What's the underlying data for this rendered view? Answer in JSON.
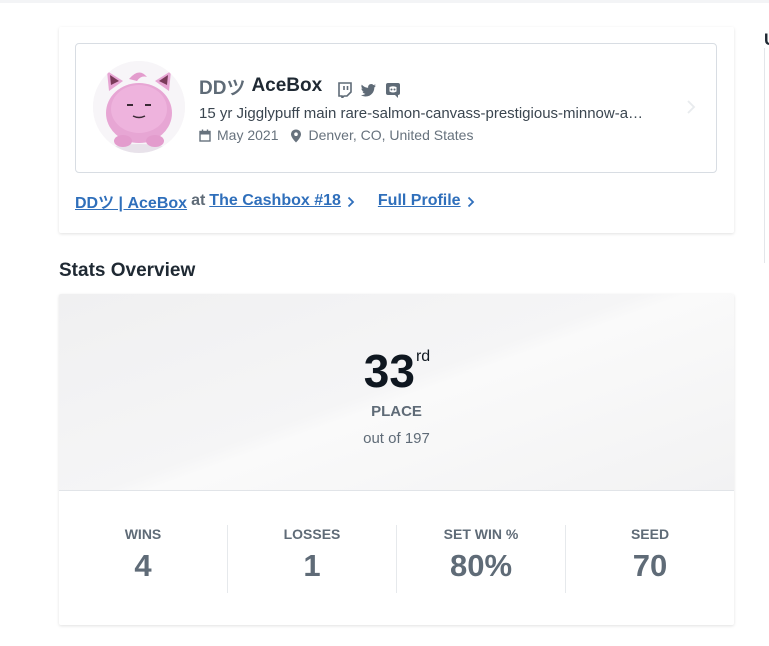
{
  "profile": {
    "prefix": "DDツ",
    "gamer_tag": "AceBox",
    "social_icons": [
      "twitch-icon",
      "twitter-icon",
      "discord-icon"
    ],
    "bio": "15 yr Jigglypuff main rare-salmon-canvass-prestigious-minnow-a…",
    "joined": "May 2021",
    "location": "Denver, CO, United States",
    "event_link": {
      "player": "DDツ | AceBox",
      "at": "at",
      "event": "The Cashbox #18"
    },
    "full_profile_label": "Full Profile"
  },
  "right_panel": {
    "letter": "U"
  },
  "stats": {
    "title": "Stats Overview",
    "placement": "33",
    "placement_suffix": "rd",
    "placement_label": "PLACE",
    "out_of": "out of 197",
    "items": [
      {
        "label": "WINS",
        "value": "4"
      },
      {
        "label": "LOSSES",
        "value": "1"
      },
      {
        "label": "SET WIN %",
        "value": "80%"
      },
      {
        "label": "SEED",
        "value": "70"
      }
    ]
  },
  "colors": {
    "link": "#2f6fbb",
    "muted": "#5f6b77",
    "text": "#1f2933"
  }
}
